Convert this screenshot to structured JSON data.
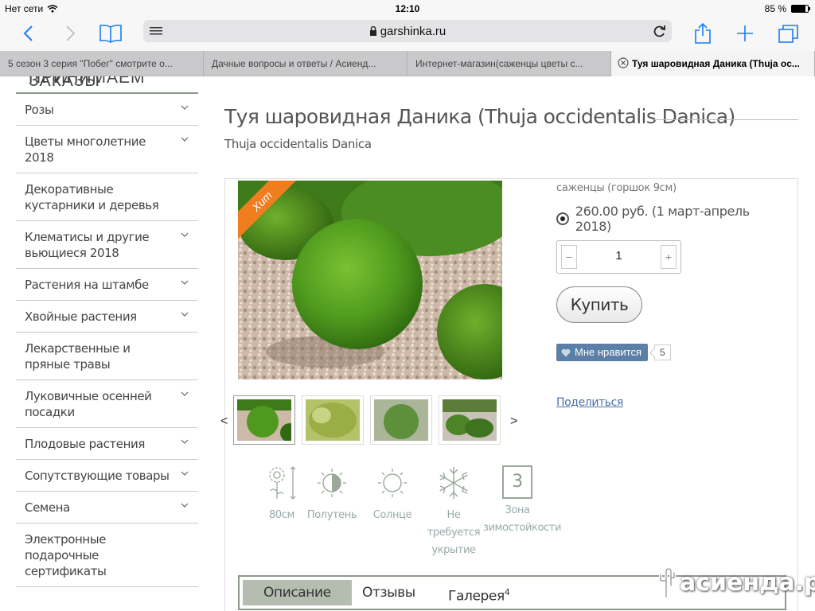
{
  "status": {
    "carrier": "Нет сети",
    "time": "12:10",
    "battery": "85 %",
    "battery_level": 0.85
  },
  "browser": {
    "url": "garshinka.ru",
    "tabs": [
      {
        "label": "5 сезон 3 серия \"Побег\" смотрите о..."
      },
      {
        "label": "Дачные вопросы и ответы / Асиенд..."
      },
      {
        "label": "Интернет-магазин(саженцы цветы с..."
      },
      {
        "label": "Туя шаровидная Даника (Thuja oc..."
      }
    ]
  },
  "sidebar": {
    "header": "Принимаем заказы",
    "categories": [
      {
        "label": "Розы"
      },
      {
        "label": "Цветы многолетние 2018"
      },
      {
        "label": "Декоративные кустарники и деревья"
      },
      {
        "label": "Клематисы и другие вьющиеся 2018"
      },
      {
        "label": "Растения на штамбе"
      },
      {
        "label": "Хвойные растения"
      },
      {
        "label": "Лекарственные и пряные травы"
      },
      {
        "label": "Луковичные осенней посадки"
      },
      {
        "label": "Плодовые растения"
      },
      {
        "label": "Сопутствующие товары"
      },
      {
        "label": "Семена"
      },
      {
        "label": "Электронные подарочные сертификаты"
      }
    ]
  },
  "product": {
    "title": "Туя шаровидная Даника (Thuja occidentalis Danica)",
    "subtitle": "Thuja occidentalis Danica",
    "badge": "Хит",
    "pack": "саженцы (горшок 9см)",
    "price": "260.00 руб. (1 март-апрель 2018)",
    "qty_minus": "−",
    "qty_plus": "+",
    "quantity": "1",
    "buy_label": "Купить",
    "like_label": "Мне нравится",
    "like_count": "5",
    "share_label": "Поделиться",
    "thumb_prev": "<",
    "thumb_next": ">",
    "properties": [
      {
        "label": "80см"
      },
      {
        "label": "Полутень"
      },
      {
        "label": "Солнце"
      },
      {
        "label": "Не требуется укрытие"
      },
      {
        "label": "Зона зимостойкости"
      }
    ],
    "zone_value": "3",
    "tabs": [
      {
        "label": "Описание"
      },
      {
        "label": "Отзывы"
      },
      {
        "label": "Галерея"
      }
    ],
    "gallery_count": "4"
  },
  "watermark": "асиенда.ру",
  "colors": {
    "accent_blue": "#1a7cf5",
    "badge_orange": "#f07d1e",
    "sage_green": "#8b9a88",
    "like_blue": "#5b7fa6"
  }
}
